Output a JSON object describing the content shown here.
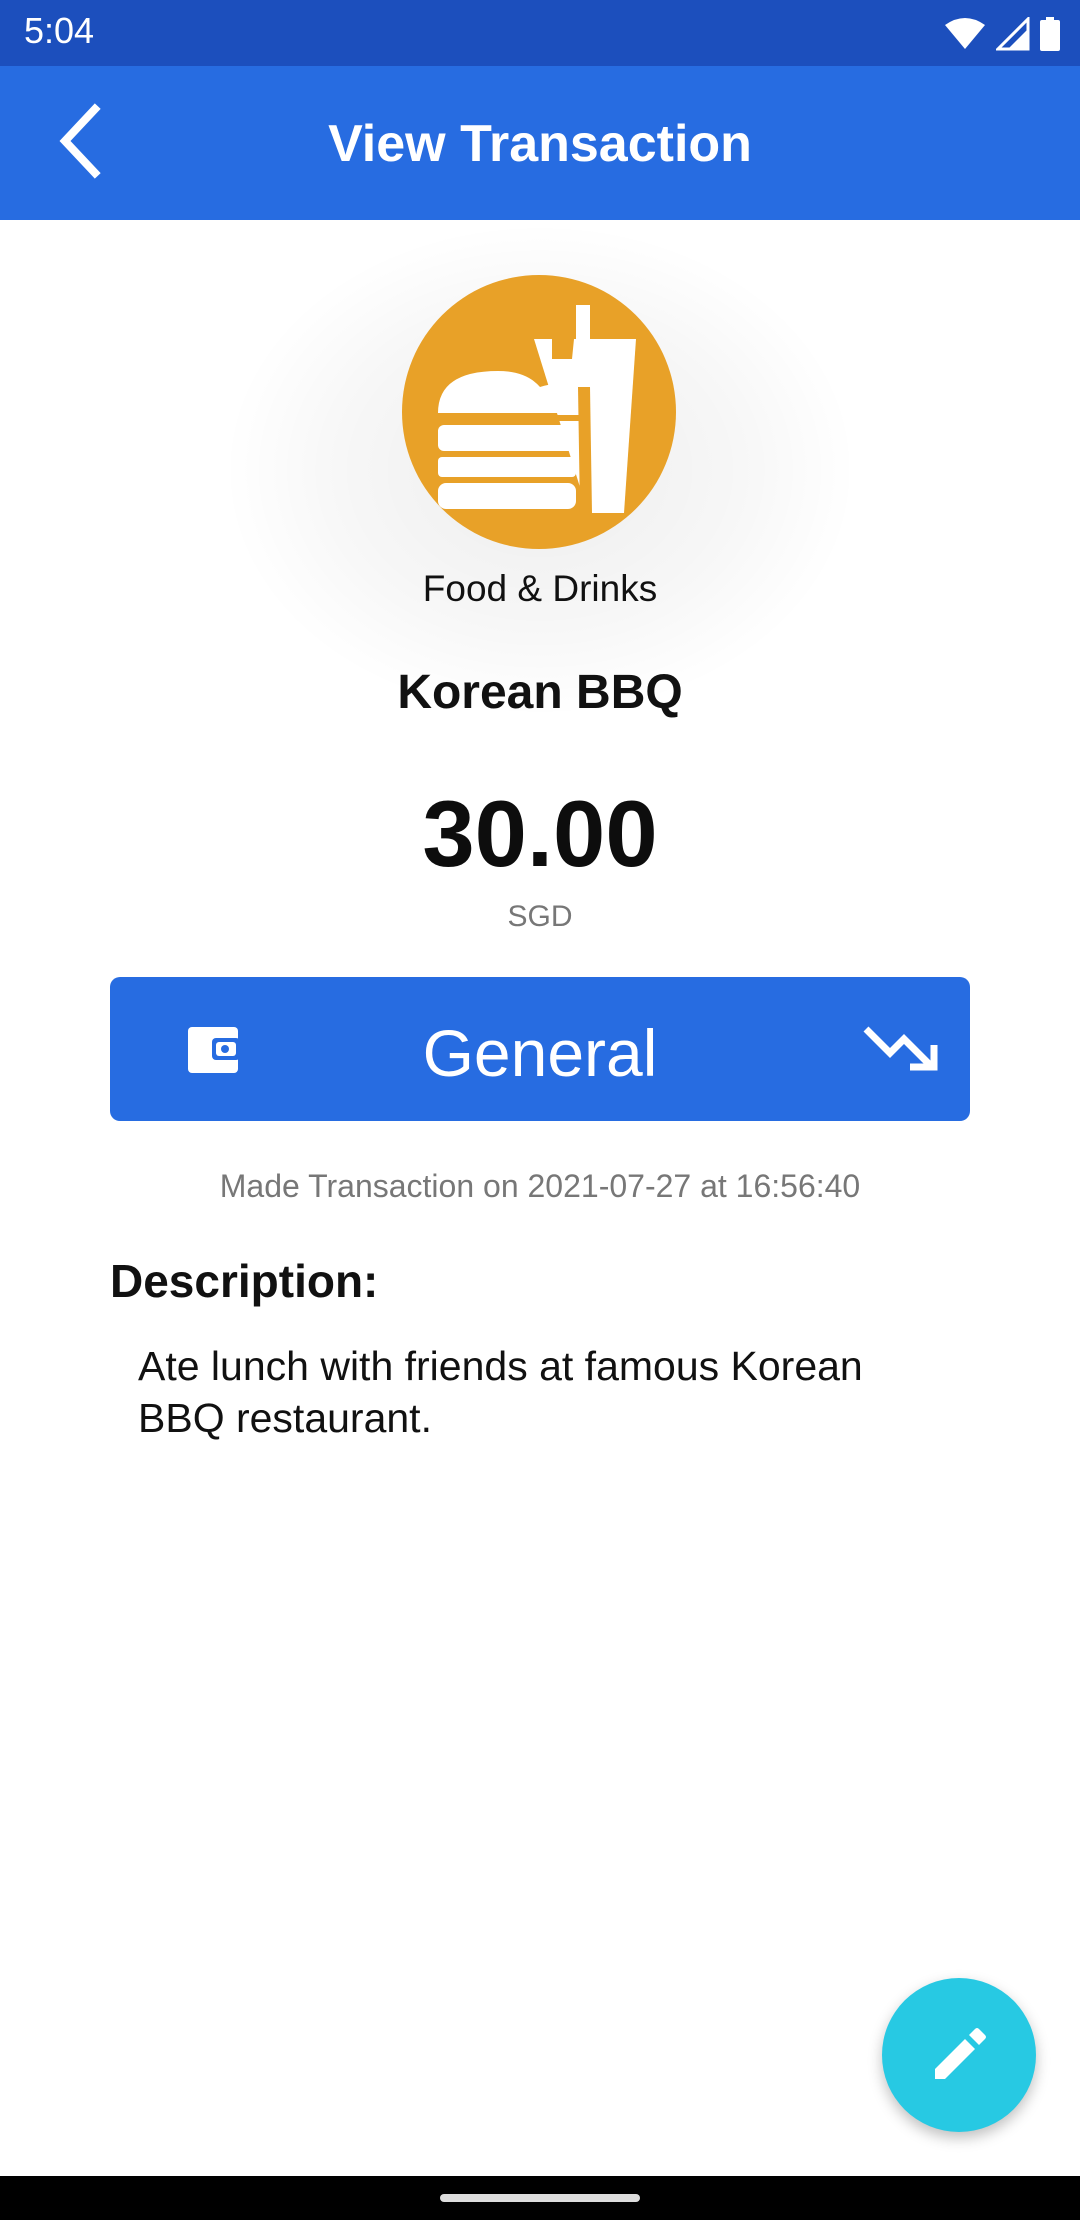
{
  "status_bar": {
    "time": "5:04"
  },
  "app_bar": {
    "title": "View Transaction",
    "back_icon": "chevron-left-icon"
  },
  "transaction": {
    "category": "Food & Drinks",
    "category_icon": "fastfood-icon",
    "category_color": "#e8a128",
    "name": "Korean BBQ",
    "amount": "30.00",
    "currency": "SGD",
    "account": "General",
    "account_icon": "wallet-icon",
    "type_icon": "trending-down-icon",
    "date_text": "Made Transaction on 2021-07-27 at 16:56:40",
    "description_label": "Description:",
    "description": "Ate lunch with friends at famous Korean BBQ restaurant."
  },
  "fab": {
    "icon": "edit-pencil-icon"
  },
  "colors": {
    "primary": "#276ce1",
    "status_bar": "#1c4fbd",
    "fab": "#27c9e3"
  }
}
